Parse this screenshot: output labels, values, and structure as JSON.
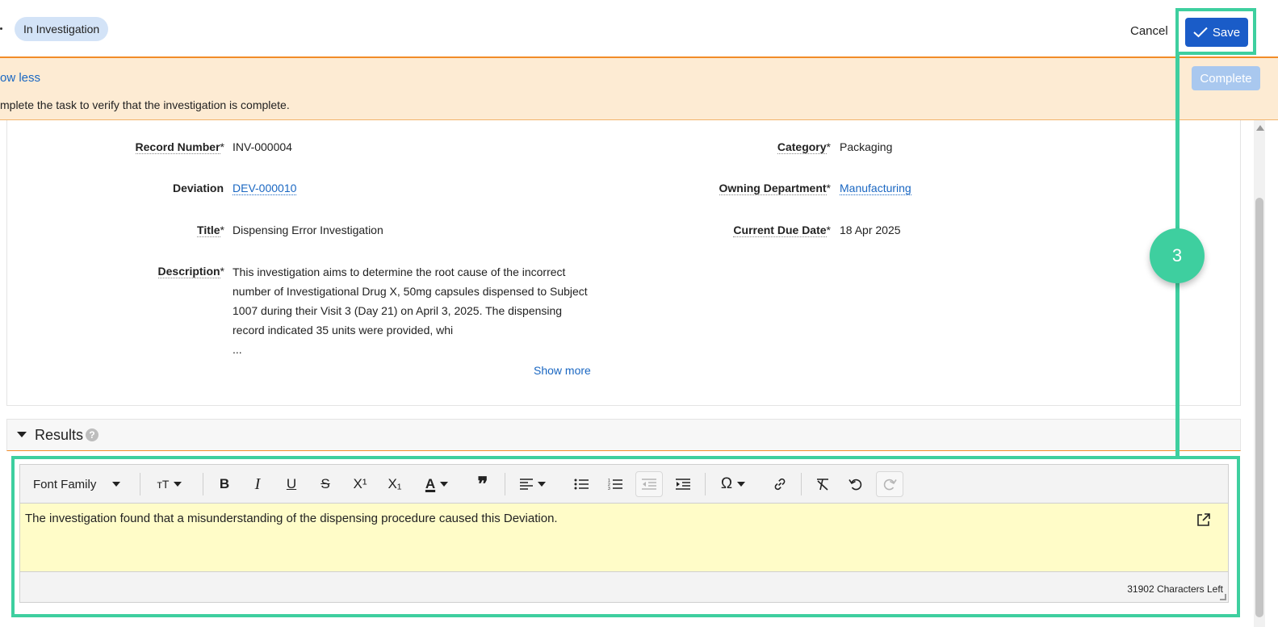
{
  "header": {
    "status": "In Investigation",
    "cancel_label": "Cancel",
    "save_label": "Save"
  },
  "banner": {
    "show_less": "ow less",
    "message": "mplete the task to verify that the investigation is complete.",
    "complete_label": "Complete"
  },
  "details": {
    "record_number_label": "Record Number",
    "record_number": "INV-000004",
    "deviation_label": "Deviation",
    "deviation": "DEV-000010",
    "title_label": "Title",
    "title": "Dispensing Error Investigation",
    "description_label": "Description",
    "description": "This investigation aims to determine the root cause of the incorrect number of Investigational Drug X, 50mg capsules dispensed to Subject 1007 during their Visit 3 (Day 21) on April 3, 2025. The dispensing record indicated 35 units were provided, whi",
    "description_ellipsis": "...",
    "show_more": "Show more",
    "category_label": "Category",
    "category": "Packaging",
    "owning_department_label": "Owning Department",
    "owning_department": "Manufacturing",
    "due_date_label": "Current Due Date",
    "due_date": "18 Apr 2025",
    "required_mark": "*"
  },
  "results": {
    "title": "Results",
    "help": "?",
    "toolbar": {
      "font_family": "Font Family"
    },
    "content": "The investigation found that a misunderstanding of the dispensing procedure caused this Deviation.",
    "chars_left": "31902 Characters Left"
  },
  "tutorial": {
    "step": "3",
    "highlight_color": "#3ecf9f"
  },
  "colors": {
    "accent_blue": "#1a5cc8",
    "banner_bg": "#fdebd3",
    "editor_bg": "#fffcc8",
    "orange_rule": "#f28c28"
  }
}
